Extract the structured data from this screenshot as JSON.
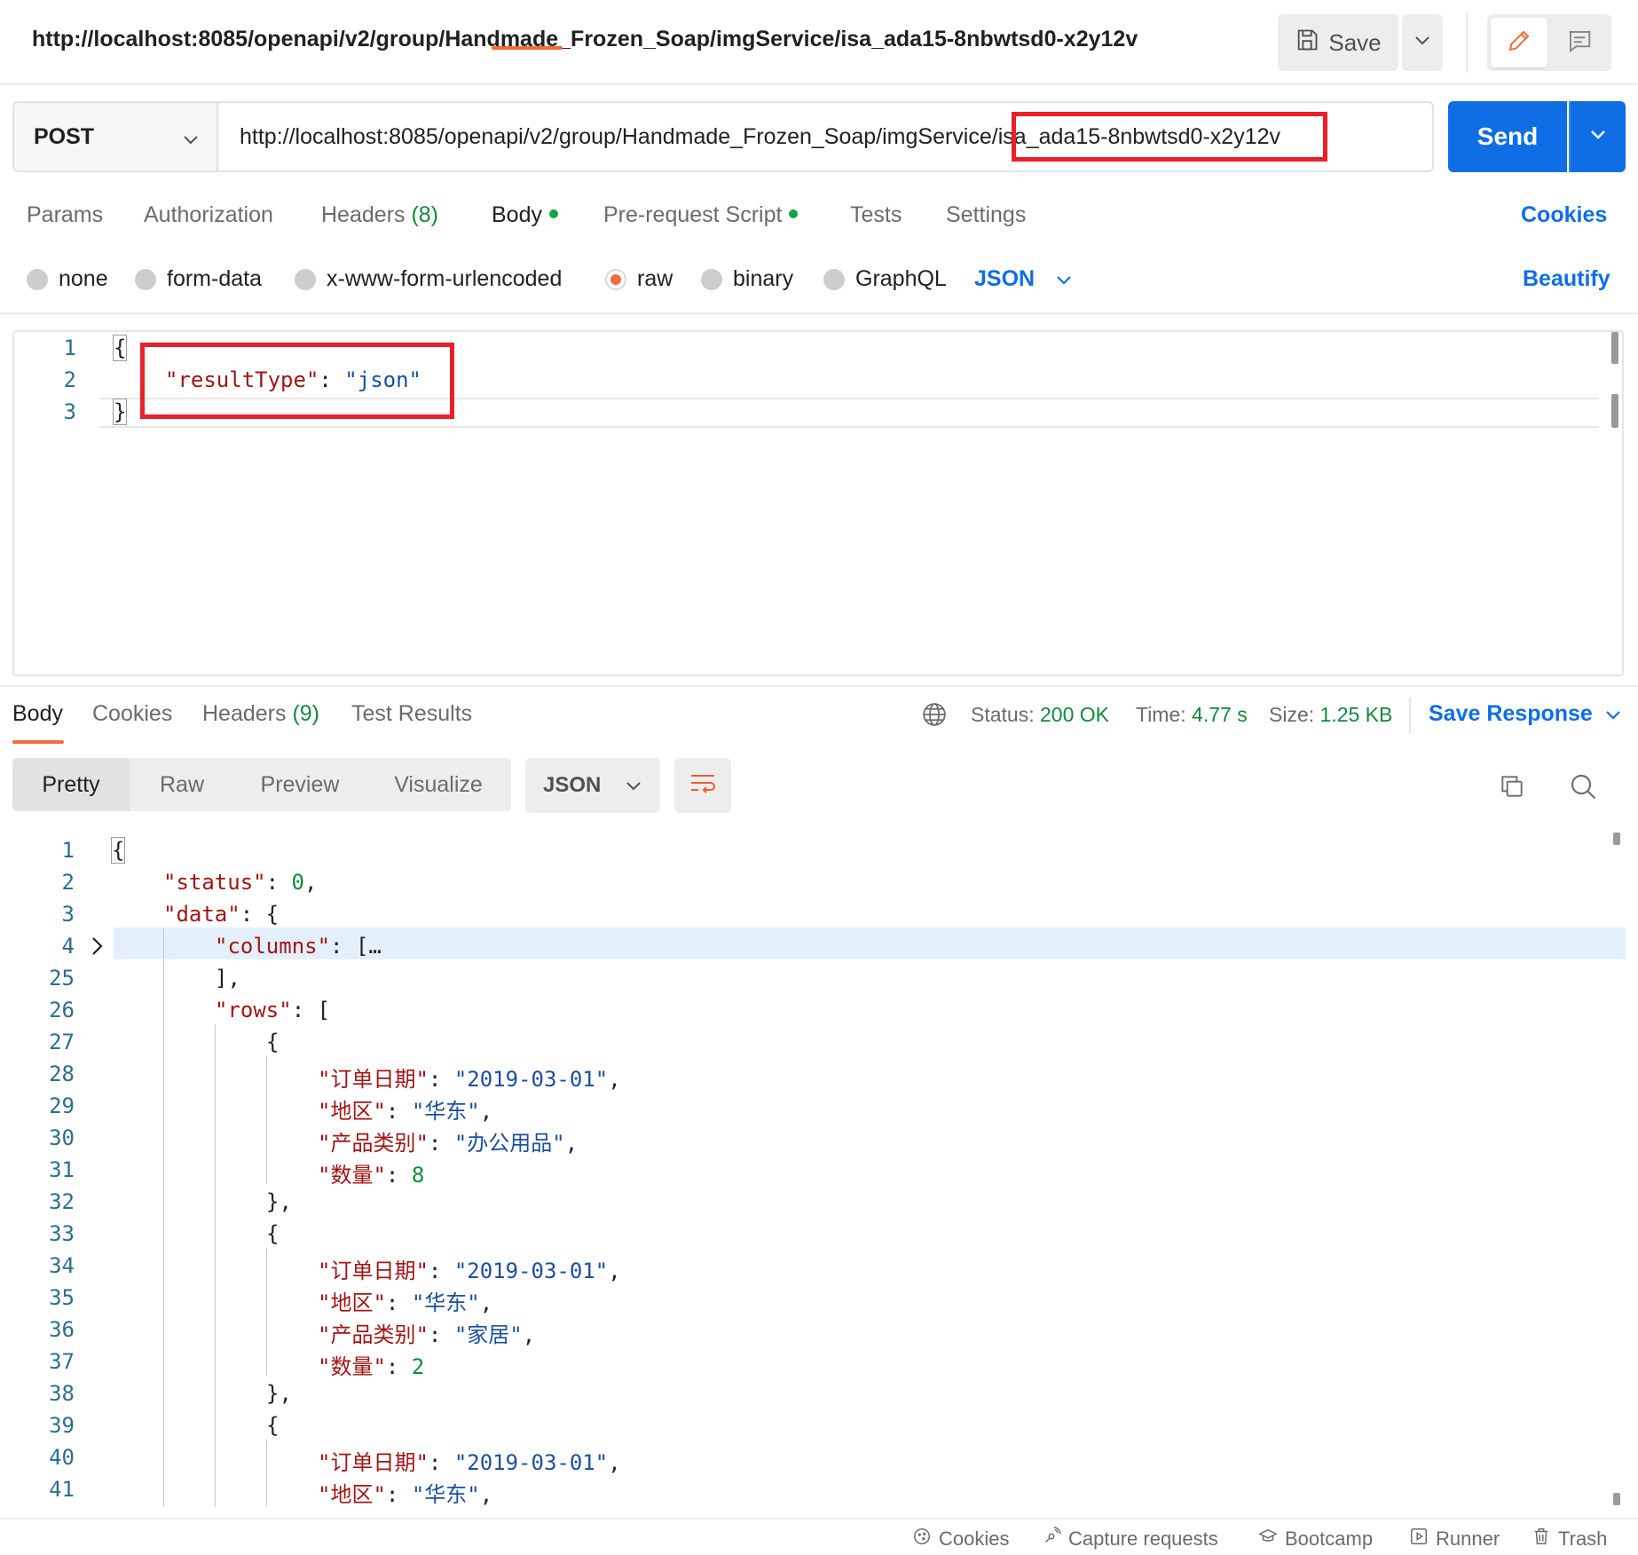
{
  "titlebar": {
    "title": "http://localhost:8085/openapi/v2/group/Handmade_Frozen_Soap/imgService/isa_ada15-8nbwtsd0-x2y12v",
    "save_label": "Save"
  },
  "request": {
    "method": "POST",
    "url_prefix": "http://localhost:8085/openapi/v2/group/Handmade_Frozen_Soap/imgService",
    "url_slash": "/",
    "url_highlighted": "isa_ada15-8nbwtsd0-x2y12v",
    "send_label": "Send"
  },
  "req_tabs": {
    "params": "Params",
    "authorization": "Authorization",
    "headers": "Headers",
    "headers_count": "(8)",
    "body": "Body",
    "prerequest": "Pre-request Script",
    "tests": "Tests",
    "settings": "Settings",
    "cookies": "Cookies"
  },
  "body_types": {
    "none": "none",
    "form_data": "form-data",
    "urlencoded": "x-www-form-urlencoded",
    "raw": "raw",
    "binary": "binary",
    "graphql": "GraphQL",
    "language": "JSON",
    "beautify": "Beautify",
    "selected": "raw"
  },
  "request_body": {
    "line_numbers": [
      "1",
      "2",
      "3"
    ],
    "open_brace": "{",
    "key": "\"resultType\"",
    "colon": ": ",
    "value": "\"json\"",
    "close_brace": "}"
  },
  "response_tabs": {
    "body": "Body",
    "cookies": "Cookies",
    "headers": "Headers",
    "headers_count": "(9)",
    "test_results": "Test Results",
    "status_label": "Status:",
    "status_value": "200 OK",
    "time_label": "Time:",
    "time_value": "4.77 s",
    "size_label": "Size:",
    "size_value": "1.25 KB",
    "save_response": "Save Response"
  },
  "view": {
    "pretty": "Pretty",
    "raw": "Raw",
    "preview": "Preview",
    "visualize": "Visualize",
    "format": "JSON"
  },
  "response_body": {
    "line_numbers": [
      "1",
      "2",
      "3",
      "4",
      "25",
      "26",
      "27",
      "28",
      "29",
      "30",
      "31",
      "32",
      "33",
      "34",
      "35",
      "36",
      "37",
      "38",
      "39",
      "40",
      "41"
    ],
    "l1": "{",
    "status_key": "\"status\"",
    "status_val": "0",
    "data_key": "\"data\"",
    "columns_key": "\"columns\"",
    "columns_fold": "[…",
    "columns_close": "],",
    "rows_key": "\"rows\"",
    "rows_open": "[",
    "obj_open": "{",
    "obj_close_comma": "},",
    "k_date": "\"订单日期\"",
    "k_region": "\"地区\"",
    "k_category": "\"产品类别\"",
    "k_qty": "\"数量\"",
    "rows": [
      {
        "date": "\"2019-03-01\"",
        "region": "\"华东\"",
        "category": "\"办公用品\"",
        "qty": "8"
      },
      {
        "date": "\"2019-03-01\"",
        "region": "\"华东\"",
        "category": "\"家居\"",
        "qty": "2"
      },
      {
        "date": "\"2019-03-01\"",
        "region": "\"华东\""
      }
    ]
  },
  "statusbar": {
    "cookies": "Cookies",
    "capture": "Capture requests",
    "bootcamp": "Bootcamp",
    "runner": "Runner",
    "trash": "Trash"
  },
  "colors": {
    "accent": "#0f6ee6",
    "active_tab": "#f26b3a",
    "highlight_box": "#e8202a",
    "success": "#0f8a3c"
  }
}
